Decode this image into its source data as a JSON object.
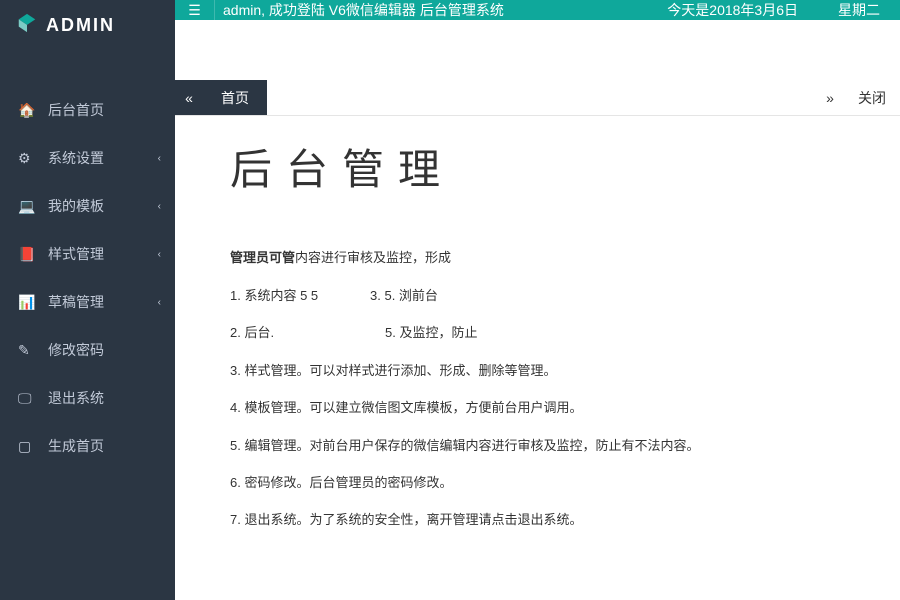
{
  "logo": {
    "text": "ADMIN"
  },
  "nav": {
    "items": [
      {
        "label": "后台首页",
        "icon": "home",
        "expandable": false
      },
      {
        "label": "系统设置",
        "icon": "cogs",
        "expandable": true
      },
      {
        "label": "我的模板",
        "icon": "laptop",
        "expandable": true
      },
      {
        "label": "样式管理",
        "icon": "book",
        "expandable": true
      },
      {
        "label": "草稿管理",
        "icon": "chart",
        "expandable": true
      },
      {
        "label": "修改密码",
        "icon": "edit",
        "expandable": false
      },
      {
        "label": "退出系统",
        "icon": "display",
        "expandable": false
      },
      {
        "label": "生成首页",
        "icon": "tablet",
        "expandable": false
      }
    ]
  },
  "topbar": {
    "message": "admin, 成功登陆  V6微信编辑器  后台管理系统",
    "date": "今天是2018年3月6日",
    "weekday": "星期二"
  },
  "tabbar": {
    "prev": "«",
    "next": "»",
    "active": "首页",
    "close_label": "关闭"
  },
  "content": {
    "title": "后台管理",
    "admin_prefix": "管理员可管",
    "admin_rest": "内容进行审核及监控，形成",
    "features": [
      {
        "n": "1",
        "text1": "系统内容 5 5",
        "n2": "3",
        "text2": "5. 浏前台"
      },
      {
        "n": "2",
        "text1": "后台.",
        "n2": "",
        "text2": "5. 及监控，防止"
      },
      {
        "n": "3",
        "text": "样式管理。可以对样式进行添加、形成、删除等管理。"
      },
      {
        "n": "4",
        "text": "模板管理。可以建立微信图文库模板，方便前台用户调用。"
      },
      {
        "n": "5",
        "text": "编辑管理。对前台用户保存的微信编辑内容进行审核及监控，防止有不法内容。"
      },
      {
        "n": "6",
        "text": "密码修改。后台管理员的密码修改。"
      },
      {
        "n": "7",
        "text": "退出系统。为了系统的安全性，离开管理请点击退出系统。"
      }
    ]
  }
}
